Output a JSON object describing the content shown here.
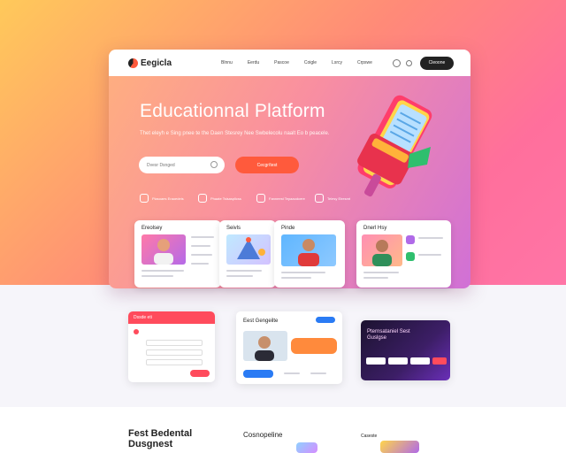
{
  "nav": {
    "brand": "Eegicla",
    "links": [
      "Blnnu",
      "Eerdu",
      "Pascoe",
      "Coigle",
      "Lsrcy",
      "Crpswe"
    ],
    "cta_label": "Cleoone"
  },
  "hero": {
    "title": "Educationnal Platform",
    "subtitle": "Thet eleyh e Sing pnee te the Daen Stesrey Nee Swbelecolu naalt Eo b peacele.",
    "search_placeholder": "Dvesr Dsnged",
    "cta_label": "Cecgr/test",
    "features": [
      "Plasoaes Eraoedeis",
      "Phaate Tsisasplicss",
      "Fanneest Tepaaodcere",
      "Telesy Eiresmt"
    ]
  },
  "cards": [
    {
      "title": "Ereolsey",
      "badge": ""
    },
    {
      "title": "Seivls",
      "badge": ""
    },
    {
      "title": "Pinde",
      "badge": ""
    },
    {
      "title": "Dnerl Hsy",
      "badge": ""
    }
  ],
  "lower": {
    "panel1_title": "Dssde eti",
    "panel2_title": "Eest Gengeilte",
    "panel3_title": "Pternsataniel Sest Guslgse",
    "section_left_title": "Fest Bedental Dusgnest",
    "section_mid_title": "Cosnopeline",
    "section_right_title": "Caseste"
  },
  "colors": {
    "accent": "#ff5a3c",
    "primary_blue": "#2a7bf4",
    "dark": "#222222"
  }
}
